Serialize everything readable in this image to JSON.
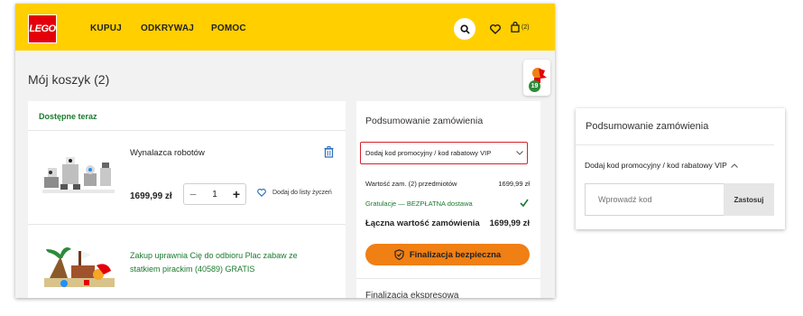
{
  "header": {
    "logo_text": "LEGO",
    "nav": [
      "KUPUJ",
      "ODKRYWAJ",
      "POMOC"
    ],
    "cart_count": "(2)"
  },
  "page": {
    "title": "Mój koszyk (2)",
    "reward_badge": "19"
  },
  "cart": {
    "availability": "Dostępne teraz",
    "items": [
      {
        "name": "Wynalazca robotów",
        "price": "1699,99 zł",
        "quantity": "1",
        "wishlist_label": "Dodaj do listy życzeń"
      },
      {
        "promo_text": "Zakup uprawnia Cię do odbioru Plac zabaw ze statkiem pirackim (40589) GRATIS"
      }
    ]
  },
  "summary": {
    "title": "Podsumowanie zamówienia",
    "promo_code_label": "Dodaj kod promocyjny / kod rabatowy VIP",
    "subtotal_label": "Wartość zam. (2) przedmiotów",
    "subtotal_value": "1699,99 zł",
    "shipping_label": "Gratulacje — BEZPŁATNA dostawa",
    "total_label": "Łączna wartość zamówienia",
    "total_value": "1699,99 zł",
    "checkout_label": "Finalizacja bezpieczna",
    "express_label": "Finalizacja ekspresowa"
  },
  "zoom_panel": {
    "title": "Podsumowanie zamówienia",
    "promo_code_label": "Dodaj kod promocyjny / kod rabatowy VIP",
    "input_placeholder": "Wprowadź kod",
    "apply_label": "Zastosuj"
  },
  "colors": {
    "header_bg": "#ffcf00",
    "logo_red": "#e3000b",
    "green": "#1a7a2e",
    "checkout_orange": "#f07f14",
    "highlight_red": "#d5222b"
  }
}
